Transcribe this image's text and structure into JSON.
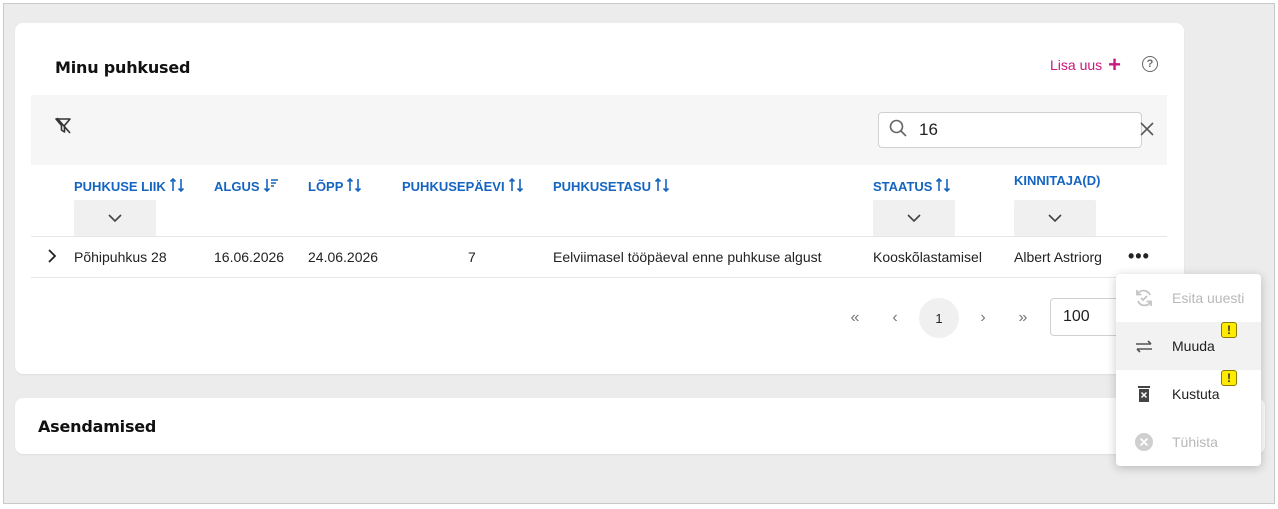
{
  "main_card": {
    "title": "Minu puhkused",
    "add_new_label": "Lisa uus",
    "help_symbol": "?"
  },
  "search": {
    "value": "16",
    "placeholder": ""
  },
  "columns": [
    {
      "label": "PUHKUSE LIIK",
      "sort": "both"
    },
    {
      "label": "ALGUS",
      "sort": "desc"
    },
    {
      "label": "LÕPP",
      "sort": "both"
    },
    {
      "label": "PUHKUSEPÄEVI",
      "sort": "both"
    },
    {
      "label": "PUHKUSETASU",
      "sort": "both"
    },
    {
      "label": "STAATUS",
      "sort": "both"
    },
    {
      "label": "KINNITAJA(D)",
      "sort": "none"
    }
  ],
  "rows": [
    {
      "type": "Põhipuhkus 28",
      "start": "16.06.2026",
      "end": "24.06.2026",
      "days": "7",
      "pay": "Eelviimasel tööpäeval enne puhkuse algust",
      "status": "Kooskõlastamisel",
      "approver": "Albert Astriorg"
    }
  ],
  "pagination": {
    "current_page": "1",
    "page_size": "100"
  },
  "row_menu": {
    "items": [
      {
        "label": "Esita uuesti",
        "enabled": false,
        "icon": "resubmit-icon"
      },
      {
        "label": "Muuda",
        "enabled": true,
        "icon": "swap-icon",
        "warning": "!"
      },
      {
        "label": "Kustuta",
        "enabled": true,
        "icon": "delete-icon",
        "warning": "!"
      },
      {
        "label": "Tühista",
        "enabled": false,
        "icon": "cancel-icon"
      }
    ]
  },
  "second_card": {
    "title": "Asendamised"
  },
  "colors": {
    "accent": "#c8197d",
    "header_link": "#1565c0",
    "warning_badge": "#ffeb00"
  }
}
